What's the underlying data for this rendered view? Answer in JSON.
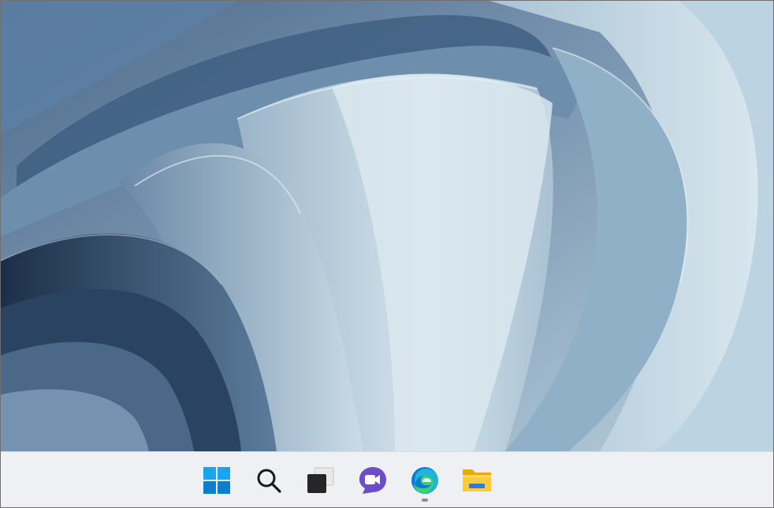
{
  "desktop": {
    "wallpaper": "windows-11-bloom-wallpaper-light",
    "colors": {
      "deep": "#1f3550",
      "mid": "#5f7f9f",
      "light": "#c9dbe6",
      "taskbar": "#eef0f3"
    }
  },
  "taskbar": {
    "items": [
      {
        "id": "start",
        "icon": "windows-logo-icon",
        "running": false
      },
      {
        "id": "search",
        "icon": "search-icon",
        "running": false
      },
      {
        "id": "task-view",
        "icon": "task-view-icon",
        "running": false
      },
      {
        "id": "chat",
        "icon": "teams-chat-icon",
        "running": false
      },
      {
        "id": "edge",
        "icon": "edge-browser-icon",
        "running": true
      },
      {
        "id": "file-explorer",
        "icon": "file-explorer-icon",
        "running": false
      }
    ]
  }
}
